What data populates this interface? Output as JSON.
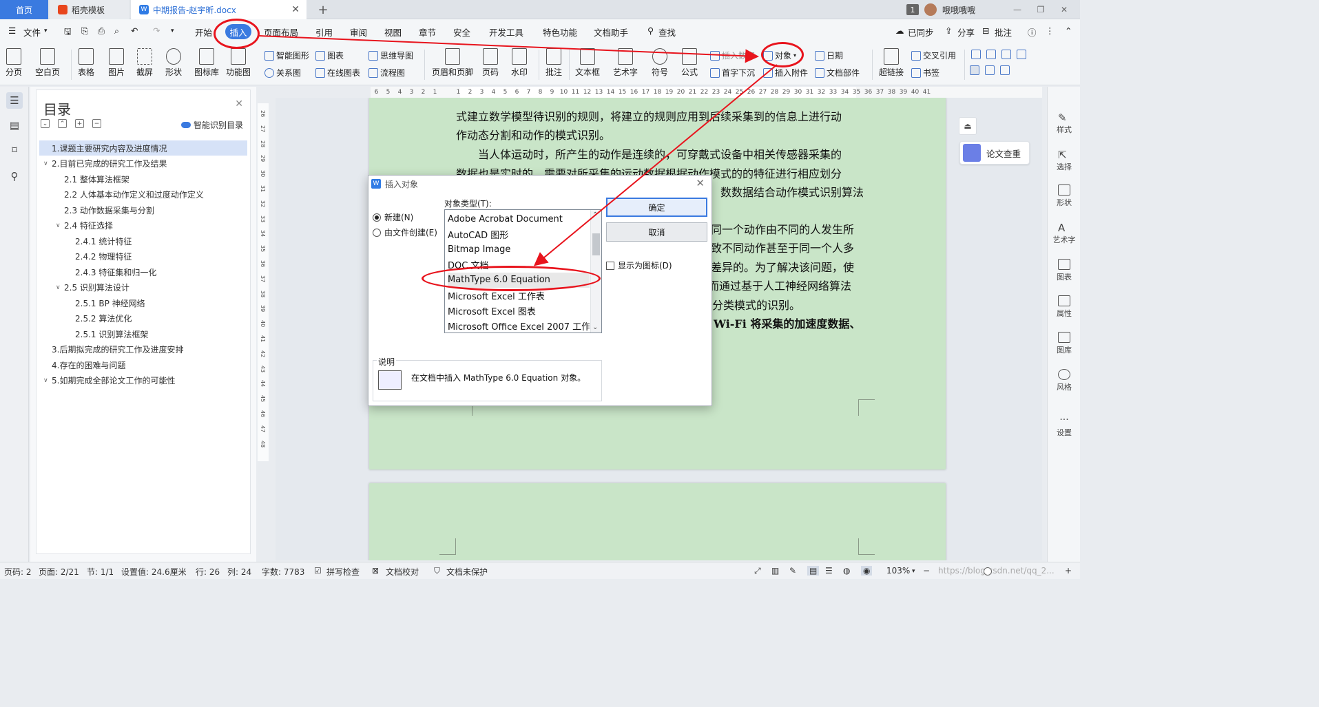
{
  "tabs": {
    "home": "首页",
    "template": "稻壳模板",
    "document": "中期报告-赵宇昕.docx",
    "badge": "1",
    "user": "哦哦哦哦"
  },
  "menu": {
    "file": "文件",
    "items": [
      "开始",
      "插入",
      "页面布局",
      "引用",
      "审阅",
      "视图",
      "章节",
      "安全",
      "开发工具",
      "特色功能",
      "文档助手"
    ],
    "search": "查找",
    "sync": "已同步",
    "share": "分享",
    "comment": "批注"
  },
  "ribbon": {
    "pagebreak": "分页",
    "blankpage": "空白页",
    "table": "表格",
    "image": "图片",
    "screenshot": "截屏",
    "shape": "形状",
    "iconlib": "图标库",
    "funcchart": "功能图",
    "smartart": "智能图形",
    "chart": "图表",
    "mindmap": "思维导图",
    "relation": "关系图",
    "onlinechart": "在线图表",
    "flowchart": "流程图",
    "headerfooter": "页眉和页脚",
    "pagenum": "页码",
    "watermark": "水印",
    "annotation": "批注",
    "textbox": "文本框",
    "wordart": "艺术字",
    "symbol": "符号",
    "formula": "公式",
    "insertnum": "插入数字",
    "dropcap": "首字下沉",
    "object": "对象",
    "attachment": "插入附件",
    "date": "日期",
    "docpart": "文档部件",
    "hyperlink": "超链接",
    "crossref": "交叉引用",
    "bookmark": "书签"
  },
  "ruler": [
    "6",
    "5",
    "4",
    "3",
    "2",
    "1",
    "",
    "1",
    "2",
    "3",
    "4",
    "5",
    "6",
    "7",
    "8",
    "9",
    "10",
    "11",
    "12",
    "13",
    "14",
    "15",
    "16",
    "17",
    "18",
    "19",
    "20",
    "21",
    "22",
    "23",
    "24",
    "25",
    "26",
    "27",
    "28",
    "29",
    "30",
    "31",
    "32",
    "33",
    "34",
    "35",
    "36",
    "37",
    "38",
    "39",
    "40",
    "41"
  ],
  "vruler": [
    "26",
    "27",
    "28",
    "29",
    "30",
    "31",
    "32",
    "33",
    "34",
    "35",
    "36",
    "37",
    "38",
    "39",
    "40",
    "41",
    "42",
    "43",
    "44",
    "45",
    "46",
    "47",
    "48"
  ],
  "toc": {
    "title": "目录",
    "smart": "智能识别目录",
    "items": [
      {
        "text": "1.课题主要研究内容及进度情况",
        "level": 0,
        "chev": ""
      },
      {
        "text": "2.目前已完成的研究工作及结果",
        "level": 0,
        "chev": "v"
      },
      {
        "text": "2.1 整体算法框架",
        "level": 1,
        "chev": ""
      },
      {
        "text": "2.2 人体基本动作定义和过度动作定义",
        "level": 1,
        "chev": ""
      },
      {
        "text": "2.3 动作数据采集与分割",
        "level": 1,
        "chev": ""
      },
      {
        "text": "2.4 特征选择",
        "level": 1,
        "chev": "v"
      },
      {
        "text": "2.4.1 统计特征",
        "level": 2,
        "chev": ""
      },
      {
        "text": "2.4.2 物理特征",
        "level": 2,
        "chev": ""
      },
      {
        "text": "2.4.3 特征集和归一化",
        "level": 2,
        "chev": ""
      },
      {
        "text": "2.5 识别算法设计",
        "level": 1,
        "chev": "v"
      },
      {
        "text": "2.5.1 BP 神经网络",
        "level": 2,
        "chev": ""
      },
      {
        "text": "2.5.2  算法优化",
        "level": 2,
        "chev": ""
      },
      {
        "text": "2.5.1  识别算法框架",
        "level": 2,
        "chev": ""
      },
      {
        "text": "3.后期拟完成的研究工作及进度安排",
        "level": 0,
        "chev": ""
      },
      {
        "text": "4.存在的困难与问题",
        "level": 0,
        "chev": ""
      },
      {
        "text": "5.如期完成全部论文工作的可能性",
        "level": 0,
        "chev": "v"
      }
    ]
  },
  "doc": {
    "lines": [
      "式建立数学模型待识别的规则，将建立的规则应用到后续采集到的信息上进行动",
      "作动态分割和动作的模式识别。",
      "　　当人体运动时，所产生的动作是连续的，可穿戴式设备中相关传感器采集的",
      "数据也是实时的。需要对所采集的运动数据根据动作模式的的特征进行相应划分",
      "数数据结合动作模式识别算法",
      "同一个动作由不同的人发生所",
      "致不同动作甚至于同一个人多",
      "差异的。为了解决该问题，使",
      "而通过基于人工神经网络算法",
      "分类模式的识别。",
      "Wi-Fi 将采集的加速度数据、"
    ]
  },
  "rightpanel": [
    "样式",
    "选择",
    "形状",
    "艺术字",
    "图表",
    "属性",
    "图库",
    "风格",
    "设置"
  ],
  "paper_check": "论文查重",
  "status": {
    "page": "页码: 2",
    "pages": "页面: 2/21",
    "section": "节: 1/1",
    "setting": "设置值: 24.6厘米",
    "row": "行: 26",
    "col": "列: 24",
    "words": "字数: 7783",
    "spell": "拼写检查",
    "proof": "文档校对",
    "protect": "文档未保护",
    "zoom": "103%",
    "watermark_url": "https://blog.csdn.net/qq_2..."
  },
  "dialog": {
    "title": "插入对象",
    "new": "新建(N)",
    "fromfile": "由文件创建(E)",
    "objtype_label": "对象类型(T):",
    "objects": [
      "Adobe Acrobat Document",
      "AutoCAD 图形",
      "Bitmap Image",
      "DOC 文档",
      "MathType 6.0 Equation",
      "Microsoft Excel 工作表",
      "Microsoft Excel 图表",
      "Microsoft Office Excel 2007 工作簿"
    ],
    "selected_index": 4,
    "ok": "确定",
    "cancel": "取消",
    "show_icon": "显示为图标(D)",
    "desc_label": "说明",
    "desc_text": "在文档中插入 MathType 6.0 Equation 对象。"
  },
  "colors": {
    "accent": "#3a7ae0",
    "annotation": "#e8141d",
    "page": "#c9e5c8"
  }
}
